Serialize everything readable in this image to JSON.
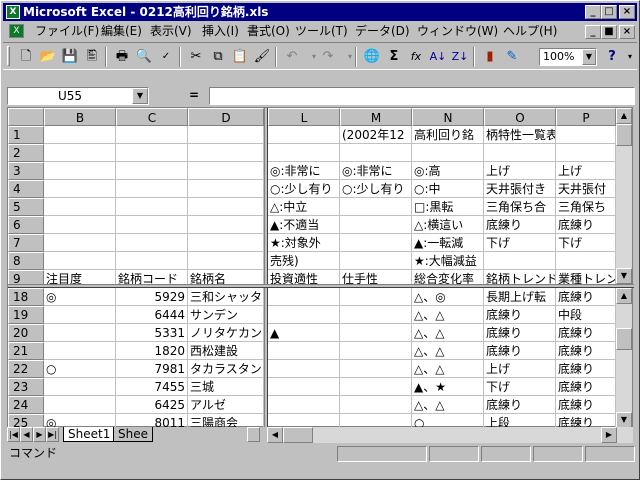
{
  "window": {
    "title": "Microsoft Excel - 0212高利回り銘柄.xls",
    "app_icon": "X"
  },
  "menu": {
    "items": [
      "ファイル(F)",
      "編集(E)",
      "表示(V)",
      "挿入(I)",
      "書式(O)",
      "ツール(T)",
      "データ(D)",
      "ウィンドウ(W)",
      "ヘルプ(H)"
    ]
  },
  "toolbar": {
    "zoom": "100%"
  },
  "formula": {
    "name_box": "U55",
    "eq": "="
  },
  "columns_left": [
    "B",
    "C",
    "D"
  ],
  "columns_right": [
    "L",
    "M",
    "N",
    "O",
    "P"
  ],
  "rows_top": [
    {
      "r": "1",
      "L": "",
      "M": "(2002年12",
      "N": "高利回り銘",
      "O": "柄特性一覧表",
      "P": ""
    },
    {
      "r": "2",
      "L": "",
      "M": "",
      "N": "",
      "O": "",
      "P": ""
    },
    {
      "r": "3",
      "L": "◎:非常に",
      "M": "◎:非常に",
      "N": "◎:高",
      "O": "上げ",
      "P": "上げ"
    },
    {
      "r": "4",
      "L": "○:少し有り",
      "M": "○:少し有り",
      "N": "○:中",
      "O": "天井張付き",
      "P": "天井張付"
    },
    {
      "r": "5",
      "L": "△:中立",
      "M": "",
      "N": "□:黒転",
      "O": "三角保ち合",
      "P": "三角保ち"
    },
    {
      "r": "6",
      "L": "▲:不適当",
      "M": "",
      "N": "△:横這い",
      "O": "底練り",
      "P": "底練り"
    },
    {
      "r": "7",
      "L": "★:対象外",
      "M": "",
      "N": "▲:一転減",
      "O": "下げ",
      "P": "下げ"
    },
    {
      "r": "8",
      "L": "売残)",
      "M": "",
      "N": "★:大幅減益",
      "O": "",
      "P": ""
    },
    {
      "r": "9",
      "L": "投資適性",
      "M": "仕手性",
      "N": "総合変化率",
      "O": "銘柄トレンド",
      "P": "業種トレン"
    }
  ],
  "rows_top_left": [
    {
      "B": "",
      "C": "",
      "D": ""
    },
    {
      "B": "",
      "C": "",
      "D": ""
    },
    {
      "B": "",
      "C": "",
      "D": ""
    },
    {
      "B": "",
      "C": "",
      "D": ""
    },
    {
      "B": "",
      "C": "",
      "D": ""
    },
    {
      "B": "",
      "C": "",
      "D": ""
    },
    {
      "B": "",
      "C": "",
      "D": ""
    },
    {
      "B": "",
      "C": "",
      "D": ""
    },
    {
      "B": "注目度",
      "C": "銘柄コード",
      "D": "銘柄名"
    }
  ],
  "rows_bottom": [
    {
      "r": "18",
      "B": "◎",
      "C": "5929",
      "D": "三和シャッタ",
      "L": "",
      "M": "",
      "N": "△、◎",
      "O": "長期上げ転",
      "P": "底練り"
    },
    {
      "r": "19",
      "B": "",
      "C": "6444",
      "D": "サンデン",
      "L": "",
      "M": "",
      "N": "△、△",
      "O": "底練り",
      "P": "中段"
    },
    {
      "r": "20",
      "B": "",
      "C": "5331",
      "D": "ノリタケカン",
      "L": "▲",
      "M": "",
      "N": "△、△",
      "O": "底練り",
      "P": "底練り"
    },
    {
      "r": "21",
      "B": "",
      "C": "1820",
      "D": "西松建設",
      "L": "",
      "M": "",
      "N": "△、△",
      "O": "底練り",
      "P": "底練り"
    },
    {
      "r": "22",
      "B": "○",
      "C": "7981",
      "D": "タカラスタン",
      "L": "",
      "M": "",
      "N": "△、△",
      "O": "上げ",
      "P": "底練り"
    },
    {
      "r": "23",
      "B": "",
      "C": "7455",
      "D": "三城",
      "L": "",
      "M": "",
      "N": "▲、★",
      "O": "下げ",
      "P": "底練り"
    },
    {
      "r": "24",
      "B": "",
      "C": "6425",
      "D": "アルゼ",
      "L": "",
      "M": "",
      "N": "△、△",
      "O": "底練り",
      "P": "底練り"
    },
    {
      "r": "25",
      "B": "◎",
      "C": "8011",
      "D": "三陽商会",
      "L": "",
      "M": "",
      "N": "○",
      "O": "上段",
      "P": "底練り"
    }
  ],
  "sheets": [
    "Sheet1",
    "Shee"
  ],
  "status": {
    "text": "コマンド"
  }
}
